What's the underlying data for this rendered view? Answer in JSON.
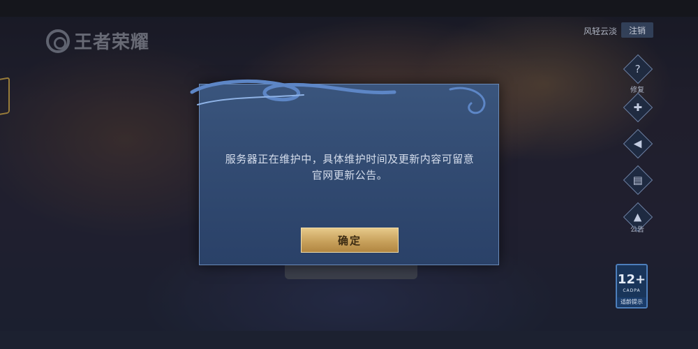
{
  "game": {
    "logo_text": "王者荣耀"
  },
  "account": {
    "username": "风轻云淡",
    "logout_label": "注销"
  },
  "side_menu": [
    {
      "icon": "question-icon",
      "glyph": "?",
      "label": "修复"
    },
    {
      "icon": "gamepad-icon",
      "glyph": "✚",
      "label": ""
    },
    {
      "icon": "speaker-icon",
      "glyph": "◀",
      "label": ""
    },
    {
      "icon": "notice-icon",
      "glyph": "▤",
      "label": ""
    },
    {
      "icon": "hat-icon",
      "glyph": "▲",
      "label": "公告"
    }
  ],
  "age_rating": {
    "age": "12+",
    "org": "CADPA",
    "tip": "适龄提示"
  },
  "dialog": {
    "message_line1": "服务器正在维护中，具体维护时间及更新内容可留意",
    "message_line2": "官网更新公告。",
    "confirm_label": "确定"
  },
  "colors": {
    "dialog_bg": "#324b72",
    "dialog_border": "#6a8ab8",
    "button_gold": "#c8a15c",
    "accent_blue": "#4d7fbc"
  }
}
